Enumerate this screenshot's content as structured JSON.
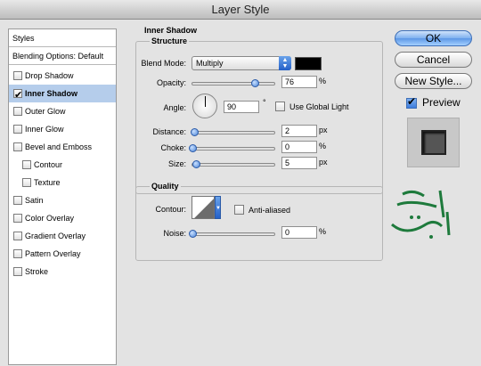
{
  "window": {
    "title": "Layer Style"
  },
  "sidebar": {
    "header": "Styles",
    "blending_options": "Blending Options: Default",
    "items": [
      {
        "label": "Drop Shadow",
        "checked": false,
        "indent": 0,
        "active": false
      },
      {
        "label": "Inner Shadow",
        "checked": true,
        "indent": 0,
        "active": true
      },
      {
        "label": "Outer Glow",
        "checked": false,
        "indent": 0,
        "active": false
      },
      {
        "label": "Inner Glow",
        "checked": false,
        "indent": 0,
        "active": false
      },
      {
        "label": "Bevel and Emboss",
        "checked": false,
        "indent": 0,
        "active": false
      },
      {
        "label": "Contour",
        "checked": false,
        "indent": 1,
        "active": false
      },
      {
        "label": "Texture",
        "checked": false,
        "indent": 1,
        "active": false
      },
      {
        "label": "Satin",
        "checked": false,
        "indent": 0,
        "active": false
      },
      {
        "label": "Color Overlay",
        "checked": false,
        "indent": 0,
        "active": false
      },
      {
        "label": "Gradient Overlay",
        "checked": false,
        "indent": 0,
        "active": false
      },
      {
        "label": "Pattern Overlay",
        "checked": false,
        "indent": 0,
        "active": false
      },
      {
        "label": "Stroke",
        "checked": false,
        "indent": 0,
        "active": false
      }
    ]
  },
  "panel": {
    "title": "Inner Shadow",
    "structure": {
      "legend": "Structure",
      "blend_mode_label": "Blend Mode:",
      "blend_mode_value": "Multiply",
      "blend_color": "#000000",
      "opacity_label": "Opacity:",
      "opacity_value": "76",
      "opacity_unit": "%",
      "angle_label": "Angle:",
      "angle_value": "90",
      "angle_unit": "°",
      "global_light_label": "Use Global Light",
      "distance_label": "Distance:",
      "distance_value": "2",
      "distance_unit": "px",
      "choke_label": "Choke:",
      "choke_value": "0",
      "choke_unit": "%",
      "size_label": "Size:",
      "size_value": "5",
      "size_unit": "px"
    },
    "quality": {
      "legend": "Quality",
      "contour_label": "Contour:",
      "anti_aliased_label": "Anti-aliased",
      "noise_label": "Noise:",
      "noise_value": "0",
      "noise_unit": "%"
    }
  },
  "buttons": {
    "ok": "OK",
    "cancel": "Cancel",
    "new_style": "New Style...",
    "preview": "Preview"
  },
  "watermark": {
    "text": "آموزش تدریس"
  },
  "colors": {
    "accent": "#5c97e6",
    "selection": "#b5cdeb",
    "watermark": "#1e7a3c"
  }
}
